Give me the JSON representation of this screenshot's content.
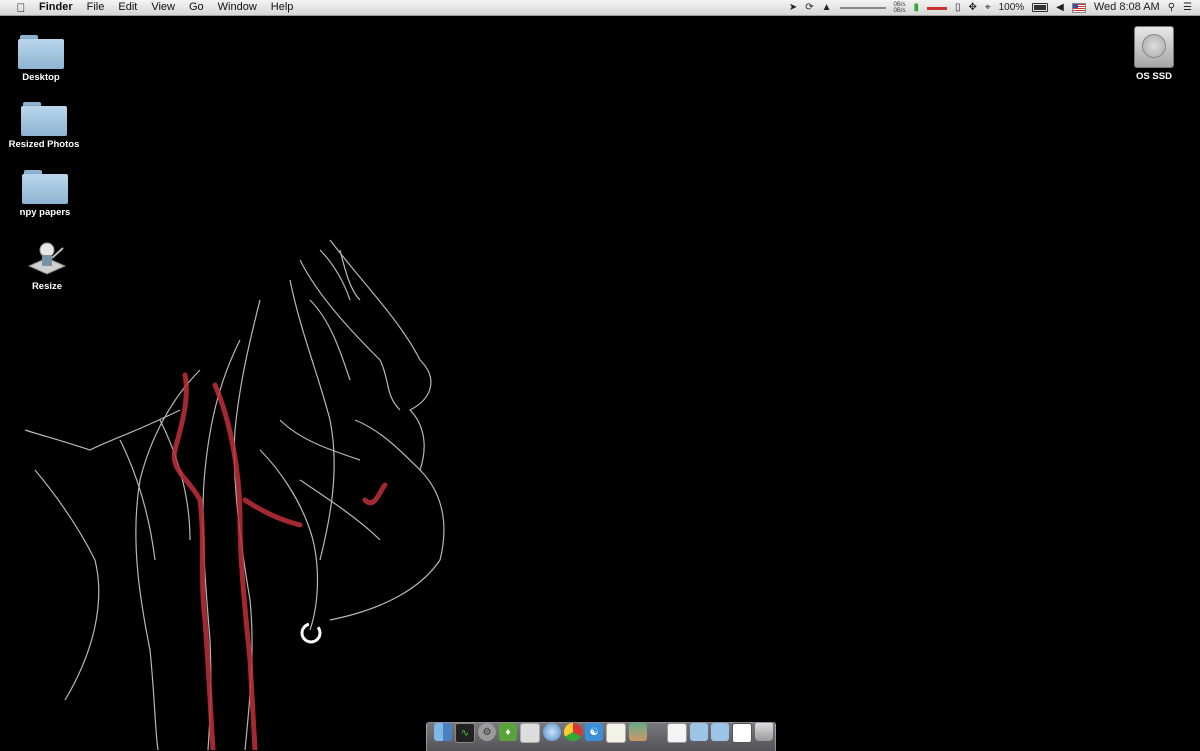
{
  "menubar": {
    "app_name": "Finder",
    "menus": [
      "File",
      "Edit",
      "View",
      "Go",
      "Window",
      "Help"
    ],
    "status": {
      "net_up": "0B/s",
      "net_down": "0B/s",
      "battery": "100%",
      "clock": "Wed 8:08 AM"
    }
  },
  "desktop_icons": {
    "desktop": "Desktop",
    "resized_photos": "Resized Photos",
    "npy_papers": "npy papers",
    "resize": "Resize",
    "os_ssd": "OS SSD"
  },
  "dock": {
    "items": [
      "finder-icon",
      "activity-monitor-icon",
      "system-preferences-icon",
      "evernote-icon",
      "preview-icon",
      "safari-icon",
      "chrome-icon",
      "twitter-icon",
      "textedit-icon",
      "photos-icon",
      "document-icon",
      "folder-icon",
      "folder-icon",
      "window-icon",
      "trash-icon"
    ]
  },
  "colors": {
    "wallpaper_bg": "#000000",
    "artery_red": "#c0303a",
    "folder_blue": "#a9cbe6"
  }
}
